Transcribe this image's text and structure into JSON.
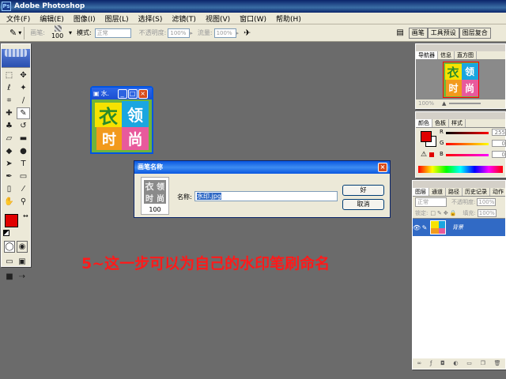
{
  "window": {
    "title": "Adobe Photoshop",
    "app_icon": "photoshop-icon"
  },
  "menubar": [
    "文件(F)",
    "编辑(E)",
    "图像(I)",
    "图层(L)",
    "选择(S)",
    "滤镜(T)",
    "视图(V)",
    "窗口(W)",
    "帮助(H)"
  ],
  "options_bar": {
    "brush_label": "画笔:",
    "brush_size": "100",
    "mode_label": "模式:",
    "mode_value": "正常",
    "opacity_label": "不透明度:",
    "opacity_value": "100%",
    "flow_label": "流量:",
    "flow_value": "100%",
    "palette_wells": [
      "画笔",
      "工具预设",
      "图层复合"
    ]
  },
  "document": {
    "title": "水.",
    "logo_chars": [
      "衣",
      "领",
      "时",
      "尚"
    ]
  },
  "dialog": {
    "title": "画笔名称",
    "preview_size": "100",
    "name_label": "名称:",
    "name_value": "水印.jpg",
    "ok_label": "好",
    "cancel_label": "取消"
  },
  "navigator_panel": {
    "tabs": [
      "导航器",
      "信息",
      "直方图"
    ],
    "zoom": "100%"
  },
  "color_panel": {
    "tabs": [
      "颜色",
      "色板",
      "样式"
    ],
    "channels": [
      {
        "label": "R",
        "value": "255"
      },
      {
        "label": "G",
        "value": "0"
      },
      {
        "label": "B",
        "value": "0"
      }
    ],
    "foreground": "#e00000",
    "background": "#ffffff"
  },
  "layers_panel": {
    "tabs": [
      "图层",
      "通道",
      "路径",
      "历史记录",
      "动作"
    ],
    "blend_mode": "正常",
    "opacity_label": "不透明度:",
    "opacity_value": "100%",
    "lock_label": "锁定:",
    "fill_label": "填充:",
    "fill_value": "100%",
    "layers": [
      {
        "name": "背景"
      }
    ]
  },
  "caption": "5~这一步可以为自己的水印笔刷命名",
  "colors": {
    "caption": "#ff1a1a",
    "workspace": "#6b6b6b",
    "title_blue": "#0a246a"
  }
}
